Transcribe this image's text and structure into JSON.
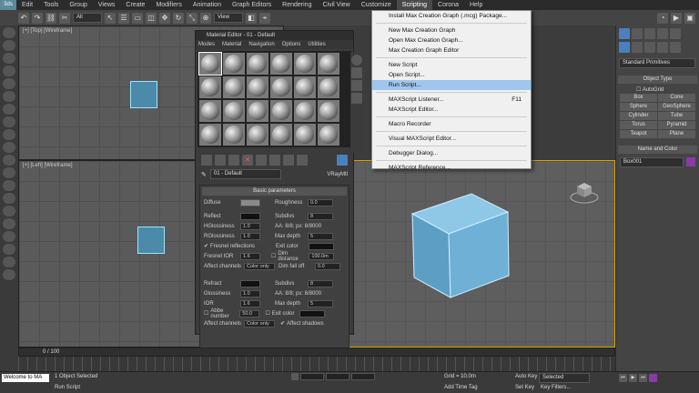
{
  "menubar": {
    "logo": "3ds",
    "items": [
      "Edit",
      "Tools",
      "Group",
      "Views",
      "Create",
      "Modifiers",
      "Animation",
      "Graph Editors",
      "Rendering",
      "Civil View",
      "Customize",
      "Scripting",
      "Corona",
      "Help"
    ],
    "active": "Scripting"
  },
  "toolbar": {
    "filter": "All",
    "view": "View"
  },
  "viewports": {
    "top": "[+] [Top] [Wireframe]",
    "left": "[+] [Left] [Wireframe]"
  },
  "material_editor": {
    "title": "Material Editor - 01 - Default",
    "menu": [
      "Modes",
      "Material",
      "Navigation",
      "Options",
      "Utilities"
    ],
    "material_name": "01 - Default",
    "material_type": "VRayMtl",
    "rollout": "Basic parameters",
    "diffuse": "Diffuse",
    "roughness": "Roughness",
    "roughness_val": "0.0",
    "reflect": "Reflect",
    "subdivs": "Subdivs",
    "subdivs_val": "8",
    "hglossiness": "HGlossiness",
    "hgloss_val": "1.0",
    "aa": "AA: 8/8; px: 8/8000",
    "rglossiness": "RGlossiness",
    "rgloss_val": "1.0",
    "max_depth": "Max depth",
    "max_depth_val": "5",
    "fresnel": "Fresnel reflections",
    "exit_color": "Exit color",
    "fresnel_ior": "Fresnel IOR",
    "fior_val": "1.6",
    "dim_distance": "Dim distance",
    "dim_val": "100.0m",
    "affect_channels": "Affect channels",
    "color_only": "Color only",
    "dim_falloff": "Dim fall off",
    "falloff_val": "0.0",
    "refract": "Refract",
    "glossiness": "Glossiness",
    "gloss_val": "1.0",
    "ior": "IOR",
    "ior_val": "1.6",
    "abbe": "Abbe number",
    "abbe_val": "50.0",
    "affect_shadows": "Affect shadows"
  },
  "scripting_menu": {
    "items": [
      {
        "label": "Install Max Creation Graph (.mcg) Package...",
        "sep": true
      },
      {
        "label": "New Max Creation Graph"
      },
      {
        "label": "Open Max Creation Graph..."
      },
      {
        "label": "Max Creation Graph Editor",
        "sep": true
      },
      {
        "label": "New Script"
      },
      {
        "label": "Open Script..."
      },
      {
        "label": "Run Script...",
        "highlight": true,
        "sep": true
      },
      {
        "label": "MAXScript Listener...",
        "shortcut": "F11"
      },
      {
        "label": "MAXScript Editor...",
        "sep": true
      },
      {
        "label": "Macro Recorder",
        "sep": true
      },
      {
        "label": "Visual MAXScript Editor...",
        "sep": true
      },
      {
        "label": "Debugger Dialog...",
        "sep": true
      },
      {
        "label": "MAXScript Reference..."
      }
    ]
  },
  "command_panel": {
    "category": "Standard Primitives",
    "object_type": "Object Type",
    "autogrid": "AutoGrid",
    "objects": [
      "Box",
      "Cone",
      "Sphere",
      "GeoSphere",
      "Cylinder",
      "Tube",
      "Torus",
      "Pyramid",
      "Teapot",
      "Plane"
    ],
    "name_color": "Name and Color",
    "object_name": "Box001",
    "swatch": "#8a3aa8"
  },
  "status": {
    "welcome": "Welcome to MA",
    "selected": "1 Object Selected",
    "prompt": "Run Script",
    "frame": "0 / 100",
    "grid": "Grid = 10.0m",
    "autokey": "Auto Key",
    "setkey": "Set Key",
    "selected_dd": "Selected",
    "keyfilters": "Key Filters...",
    "addtimetag": "Add Time Tag"
  },
  "colors": {
    "accent": "#66b8e0",
    "highlight": "#9fc6ee"
  }
}
